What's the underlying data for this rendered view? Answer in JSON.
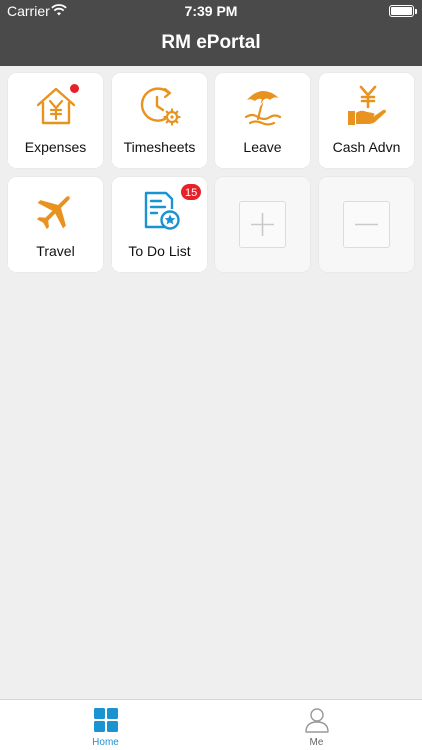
{
  "status_bar": {
    "carrier": "Carrier",
    "time": "7:39 PM"
  },
  "header": {
    "title": "RM ePortal"
  },
  "tiles": [
    {
      "label": "Expenses",
      "icon": "house-yen-icon",
      "color": "#e8931f",
      "badge_dot": true
    },
    {
      "label": "Timesheets",
      "icon": "clock-gear-icon",
      "color": "#e8931f"
    },
    {
      "label": "Leave",
      "icon": "beach-umbrella-icon",
      "color": "#e8931f"
    },
    {
      "label": "Cash Advn",
      "icon": "hand-yen-icon",
      "color": "#e8931f"
    },
    {
      "label": "Travel",
      "icon": "airplane-icon",
      "color": "#e8931f"
    },
    {
      "label": "To Do List",
      "icon": "document-star-icon",
      "color": "#1b93d1",
      "badge": "15"
    },
    {
      "icon": "plus-icon"
    },
    {
      "icon": "minus-icon"
    }
  ],
  "tab_bar": {
    "tabs": [
      {
        "label": "Home",
        "icon": "grid-icon",
        "active": true,
        "color": "#1b93d1"
      },
      {
        "label": "Me",
        "icon": "person-icon",
        "active": false,
        "color": "#999999"
      }
    ]
  }
}
